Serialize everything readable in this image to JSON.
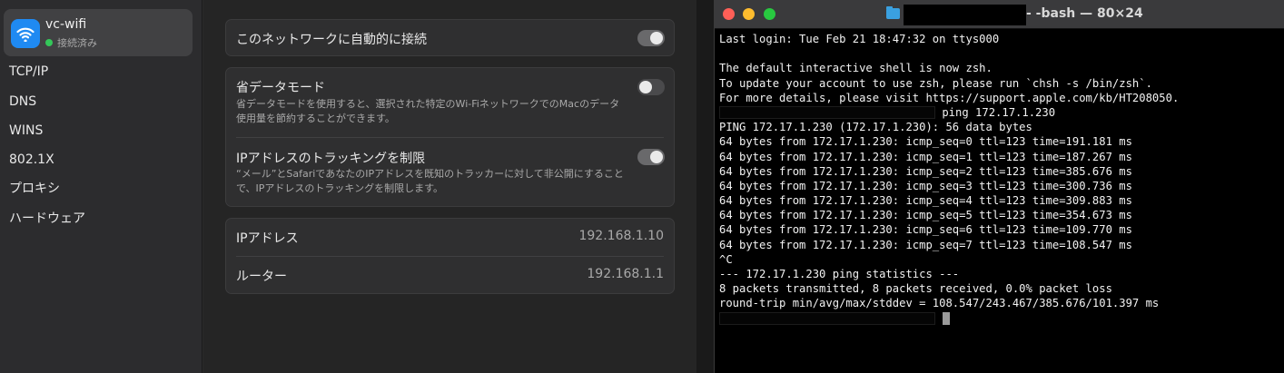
{
  "settings": {
    "network": {
      "name": "vc-wifi",
      "status": "接続済み"
    },
    "nav": [
      "TCP/IP",
      "DNS",
      "WINS",
      "802.1X",
      "プロキシ",
      "ハードウェア"
    ],
    "auto_join": {
      "label": "このネットワークに自動的に接続",
      "enabled": true
    },
    "low_data": {
      "label": "省データモード",
      "description": "省データモードを使用すると、選択された特定のWi-FiネットワークでのMacのデータ使用量を節約することができます。",
      "enabled": false
    },
    "limit_tracking": {
      "label": "IPアドレスのトラッキングを制限",
      "description": "“メール”とSafariであなたのIPアドレスを既知のトラッカーに対して非公開にすることで、IPアドレスのトラッキングを制限します。",
      "enabled": true
    },
    "ip": {
      "label": "IPアドレス",
      "value": "192.168.1.10"
    },
    "router": {
      "label": "ルーター",
      "value": "192.168.1.1"
    }
  },
  "terminal": {
    "title": "- -bash — 80×24",
    "lines": [
      "Last login: Tue Feb 21 18:47:32 on ttys000",
      "",
      "The default interactive shell is now zsh.",
      "To update your account to use zsh, please run `chsh -s /bin/zsh`.",
      "For more details, please visit https://support.apple.com/kb/HT208050."
    ],
    "command": " ping 172.17.1.230",
    "output": [
      "PING 172.17.1.230 (172.17.1.230): 56 data bytes",
      "64 bytes from 172.17.1.230: icmp_seq=0 ttl=123 time=191.181 ms",
      "64 bytes from 172.17.1.230: icmp_seq=1 ttl=123 time=187.267 ms",
      "64 bytes from 172.17.1.230: icmp_seq=2 ttl=123 time=385.676 ms",
      "64 bytes from 172.17.1.230: icmp_seq=3 ttl=123 time=300.736 ms",
      "64 bytes from 172.17.1.230: icmp_seq=4 ttl=123 time=309.883 ms",
      "64 bytes from 172.17.1.230: icmp_seq=5 ttl=123 time=354.673 ms",
      "64 bytes from 172.17.1.230: icmp_seq=6 ttl=123 time=109.770 ms",
      "64 bytes from 172.17.1.230: icmp_seq=7 ttl=123 time=108.547 ms",
      "^C",
      "--- 172.17.1.230 ping statistics ---",
      "8 packets transmitted, 8 packets received, 0.0% packet loss",
      "round-trip min/avg/max/stddev = 108.547/243.467/385.676/101.397 ms"
    ]
  }
}
